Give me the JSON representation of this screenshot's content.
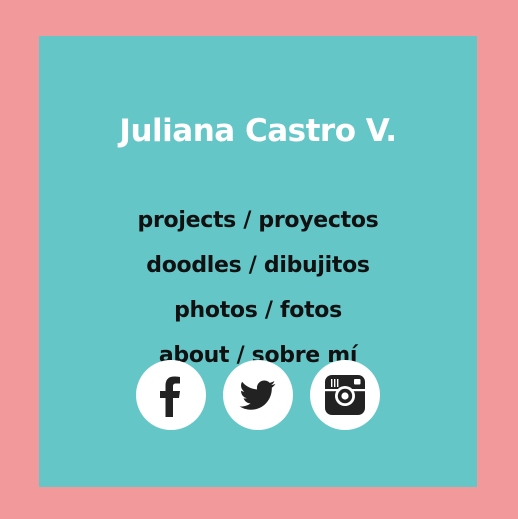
{
  "site": {
    "title": "Juliana Castro V."
  },
  "nav": {
    "items": [
      {
        "label": "projects / proyectos"
      },
      {
        "label": "doodles / dibujitos"
      },
      {
        "label": "photos / fotos"
      },
      {
        "label": "about / sobre mí"
      }
    ]
  },
  "social": {
    "icons": [
      "facebook-icon",
      "twitter-icon",
      "instagram-icon"
    ]
  },
  "colors": {
    "background": "#f2999c",
    "card": "#65c6c8",
    "title": "#ffffff",
    "links": "#111111",
    "icon_circle": "#ffffff",
    "icon_glyph": "#222222"
  }
}
